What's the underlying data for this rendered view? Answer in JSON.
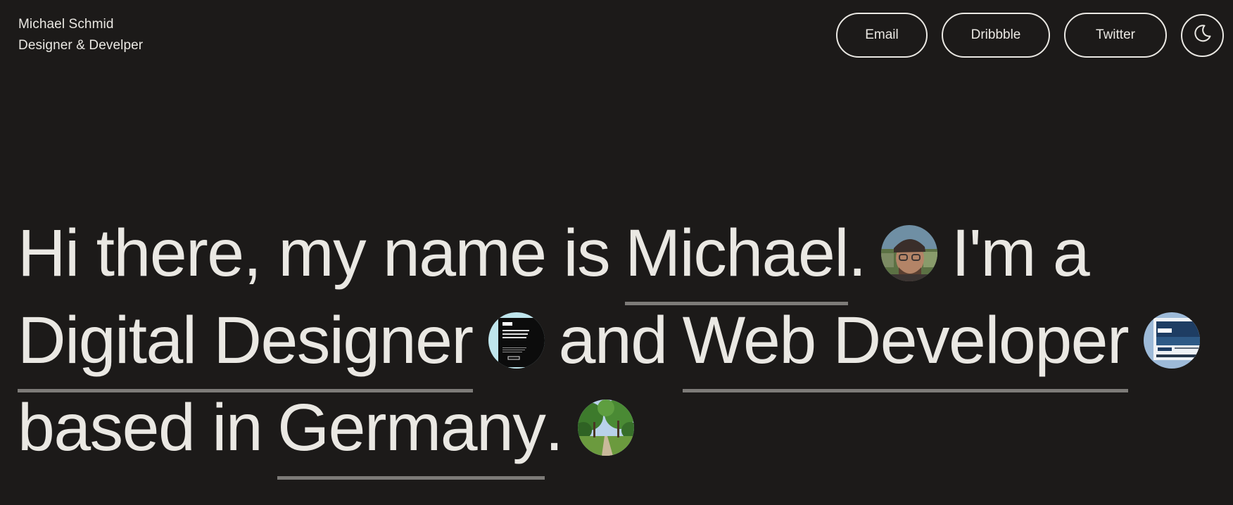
{
  "header": {
    "name": "Michael Schmid",
    "role": "Designer & Develper"
  },
  "nav": {
    "email_label": "Email",
    "dribbble_label": "Dribbble",
    "twitter_label": "Twitter",
    "theme_icon": "moon-icon"
  },
  "hero": {
    "l1_a": "Hi there, my name is",
    "l1_link": "Michael",
    "l1_dot": ".",
    "l1_b": "I'm a",
    "l2_link1": "Digital Designer",
    "l2_and": "and",
    "l2_link2": "Web Developer",
    "l3_a": "based in",
    "l3_link": "Germany",
    "l3_dot": "."
  },
  "colors": {
    "background": "#1c1a19",
    "text": "#eae8e3",
    "underline": "#7d7b78"
  },
  "images": {
    "portrait": "portrait-photo",
    "design_work": "design-work-thumbnail",
    "web_work": "web-work-thumbnail",
    "landscape": "germany-landscape-photo"
  }
}
